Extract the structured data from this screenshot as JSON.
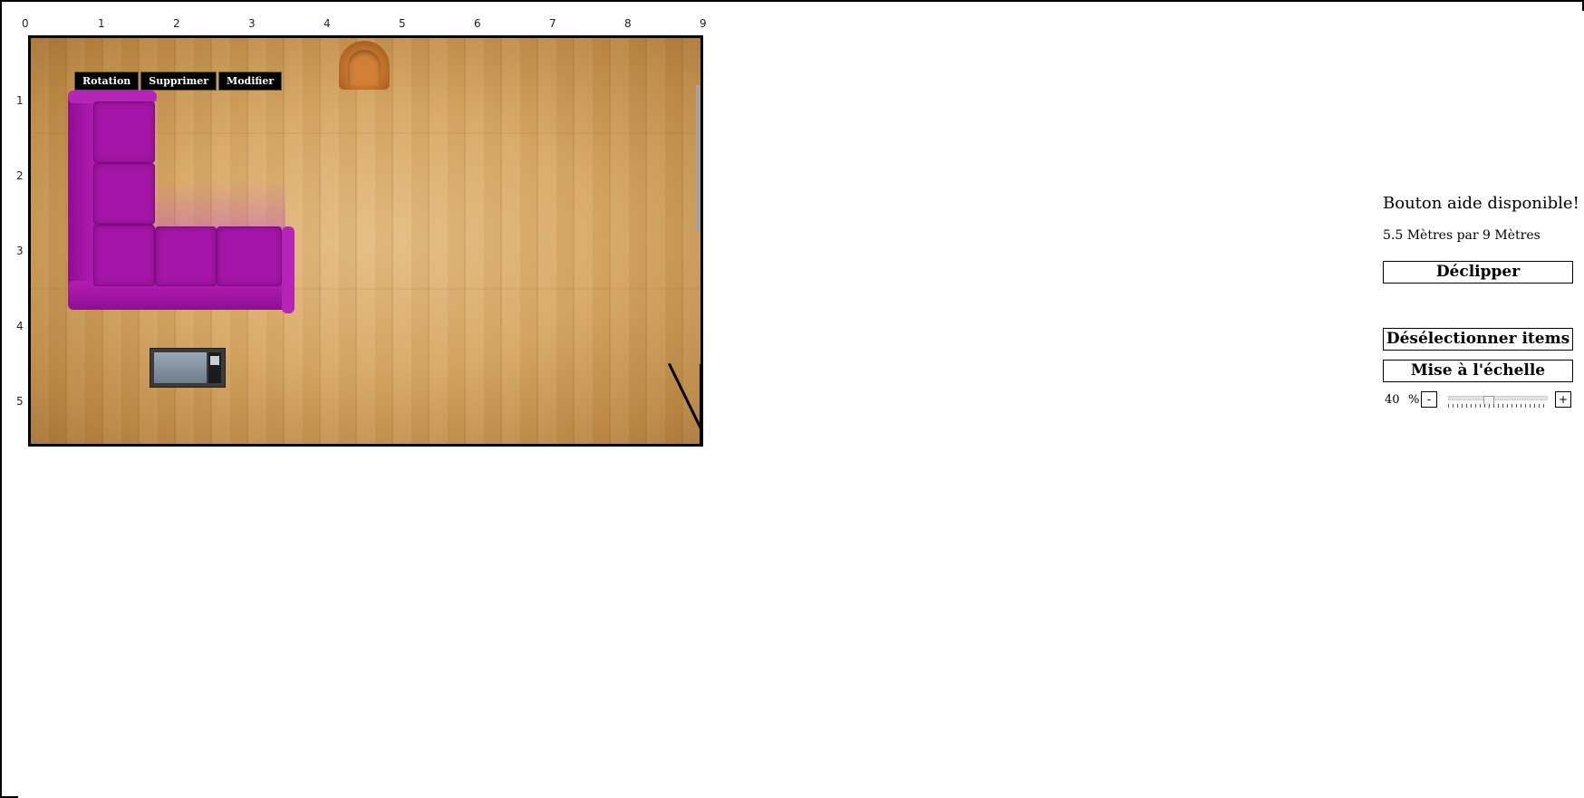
{
  "ruler": {
    "x_labels": [
      "0",
      "1",
      "2",
      "3",
      "4",
      "5",
      "6",
      "7",
      "8",
      "9"
    ],
    "y_labels": [
      "1",
      "2",
      "3",
      "4",
      "5"
    ]
  },
  "item_toolbar": {
    "rotation": "Rotation",
    "delete": "Supprimer",
    "modify": "Modifier"
  },
  "panel": {
    "help": "Bouton aide disponible!",
    "dimensions": "5.5 Mètres par 9 Mètres",
    "unclip": "Déclipper",
    "deselect": "Désélectionner items",
    "scale": "Mise à l'échelle",
    "zoom_value": "40",
    "zoom_unit": "%",
    "zoom_minus": "-",
    "zoom_plus": "+",
    "zoom_level": 0.4
  },
  "colors": {
    "sofa": "#a516a8",
    "floor": "#d7a866"
  }
}
